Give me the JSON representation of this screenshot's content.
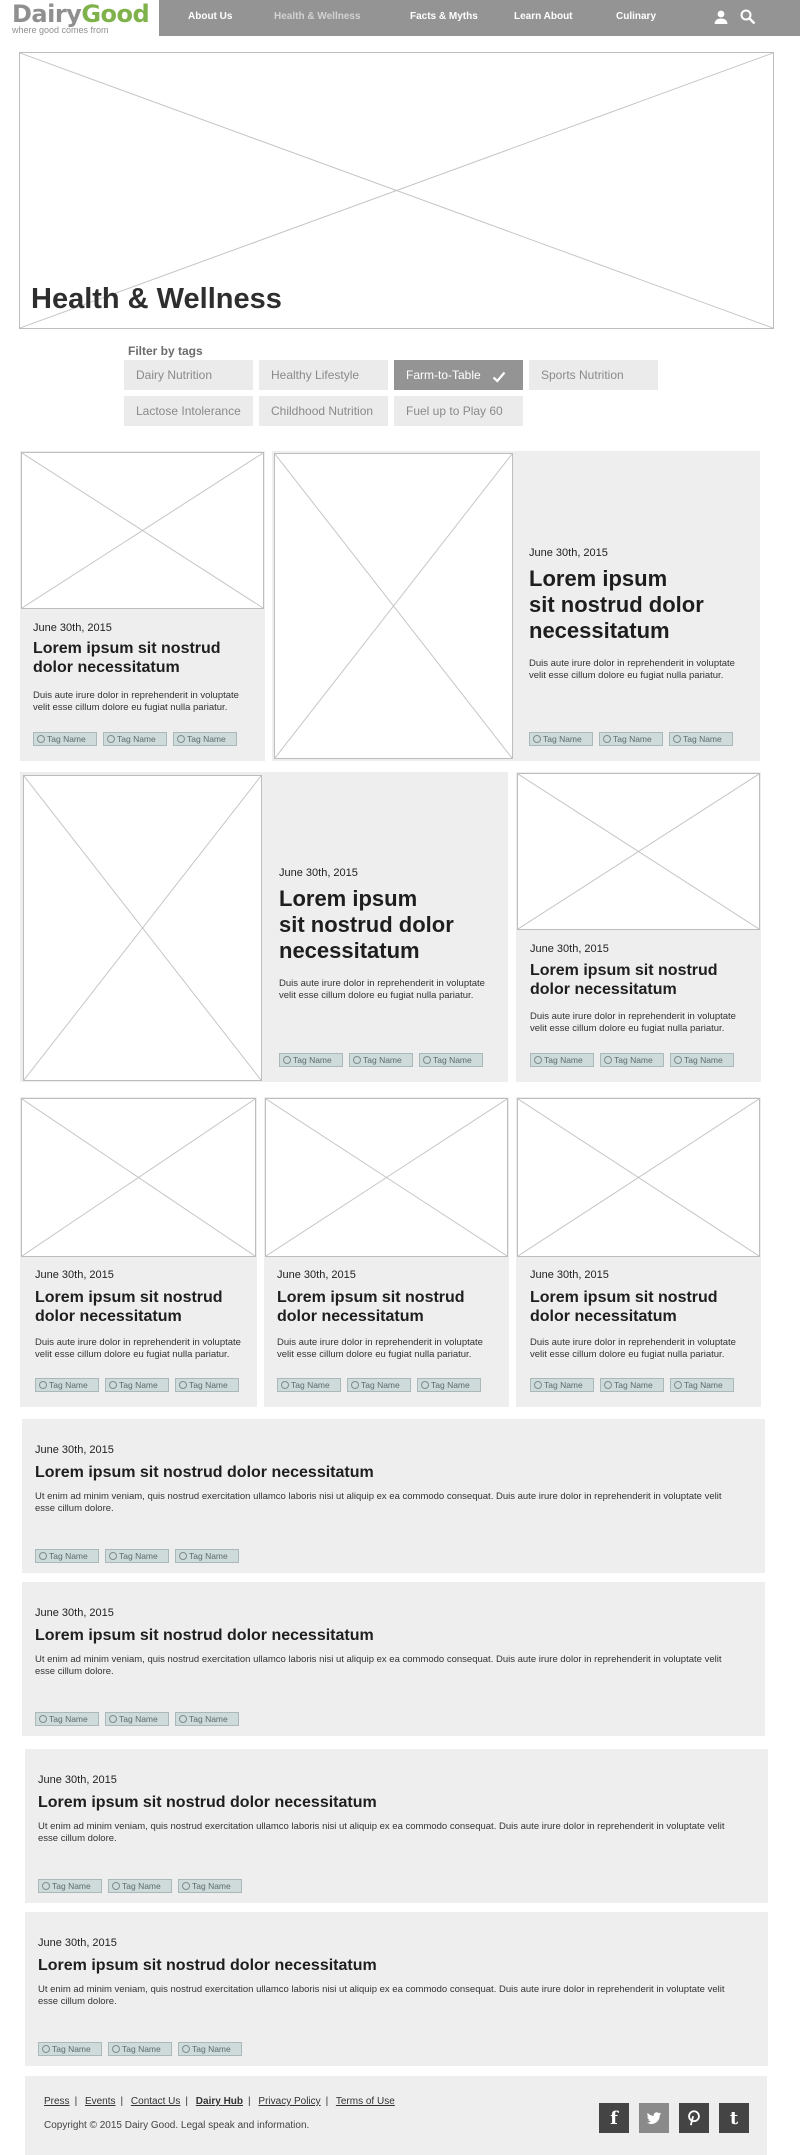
{
  "logo": {
    "word_part1": "Dairy",
    "word_part2": "Good",
    "tagline": "where good comes from"
  },
  "nav": {
    "items": [
      {
        "label": "About Us"
      },
      {
        "label": "Health & Wellness"
      },
      {
        "label": "Facts & Myths"
      },
      {
        "label": "Learn About"
      },
      {
        "label": "Culinary"
      }
    ],
    "icons": [
      "user-icon",
      "search-icon"
    ]
  },
  "page": {
    "title": "Health & Wellness"
  },
  "filters": {
    "label": "Filter by tags",
    "tags": [
      {
        "label": "Dairy Nutrition",
        "selected": false
      },
      {
        "label": "Healthy Lifestyle",
        "selected": false
      },
      {
        "label": "Farm-to-Table",
        "selected": true
      },
      {
        "label": "Sports Nutrition",
        "selected": false
      },
      {
        "label": "Lactose Intolerance",
        "selected": false
      },
      {
        "label": "Childhood Nutrition",
        "selected": false
      },
      {
        "label": "Fuel up to Play 60",
        "selected": false
      }
    ]
  },
  "article": {
    "date": "June 30th, 2015",
    "title_short": "Lorem ipsum sit nostrud dolor necessitatum",
    "title_big_line1": "Lorem ipsum",
    "title_big_line2": "sit nostrud dolor necessitatum",
    "body_short": "Duis aute irure dolor in reprehenderit in voluptate velit esse cillum dolore eu fugiat nulla pariatur.",
    "body_long": "Ut enim ad minim veniam, quis nostrud exercitation ullamco laboris nisi ut aliquip ex ea commodo consequat. Duis aute irure dolor in reprehenderit in voluptate velit esse cillum dolore.",
    "tag_label": "Tag Name"
  },
  "footer": {
    "links": [
      "Press",
      "Events",
      "Contact Us",
      "Dairy Hub",
      "Privacy Policy",
      "Terms of Use"
    ],
    "copyright": "Copyright © 2015 Dairy Good. Legal speak and information.",
    "social": [
      "facebook-icon",
      "twitter-icon",
      "pinterest-icon",
      "tumblr-icon"
    ]
  },
  "colors": {
    "nav_bg": "#949494",
    "card_bg": "#eeeeee",
    "brand_green": "#7fb24a",
    "tag_bg": "#cfdadb"
  }
}
